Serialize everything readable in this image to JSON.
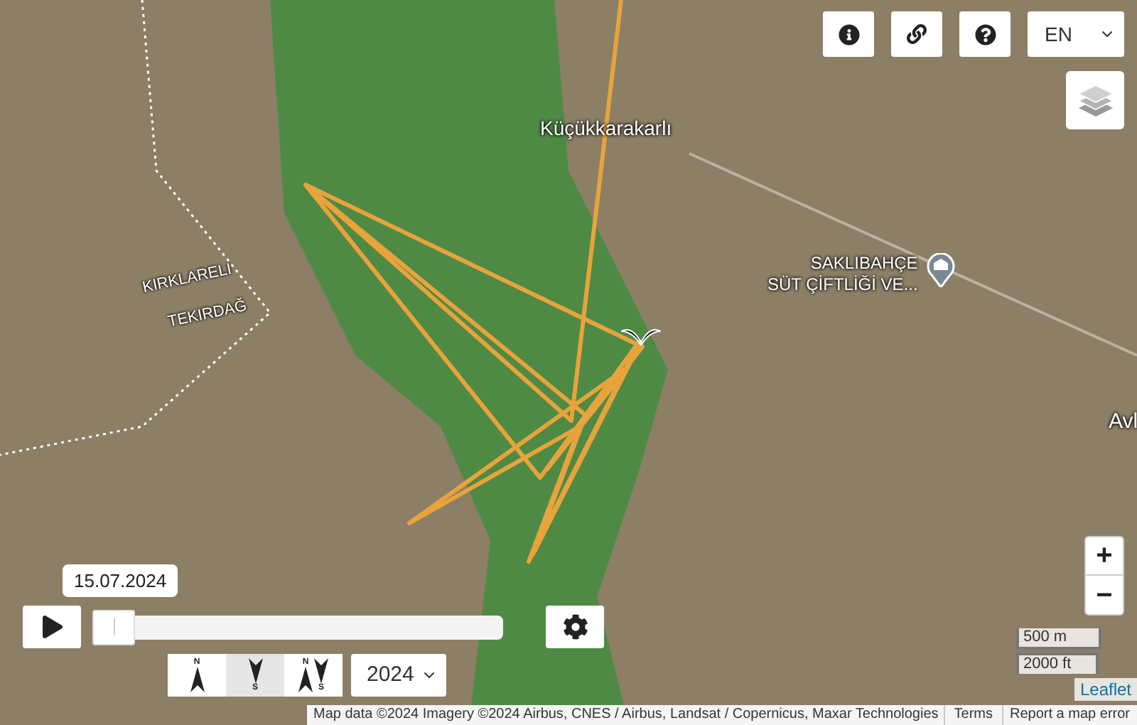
{
  "map_labels": [
    "Küçükkarakarlı",
    "KIRKLARELI",
    "TEKIRDAĞ",
    "SAKLIBAHÇE\nSÜT ÇİFTLİĞİ VE...",
    "Avl"
  ],
  "top_buttons": [
    {
      "kind": "info"
    },
    {
      "kind": "link"
    },
    {
      "kind": "help"
    }
  ],
  "language": {
    "value": "EN"
  },
  "timeline": {
    "date": "15.07.2024",
    "level": 0
  },
  "direction_buttons": [
    {
      "kind": "north",
      "north": "N",
      "selected": false
    },
    {
      "kind": "south",
      "south": "S",
      "selected": true
    },
    {
      "kind": "both",
      "north": "N",
      "south": "S",
      "selected": false
    }
  ],
  "year": {
    "value": "2024"
  },
  "zoom": {
    "in": "+",
    "out": "−"
  },
  "scale": {
    "metric": "500 m",
    "imperial": "2000 ft"
  },
  "attribution": {
    "leaflet": "Leaflet",
    "text": "Map data ©2024 Imagery ©2024 Airbus, CNES / Airbus, Landsat / Copernicus, Maxar Technologies",
    "terms": "Terms",
    "report": "Report a map error"
  }
}
